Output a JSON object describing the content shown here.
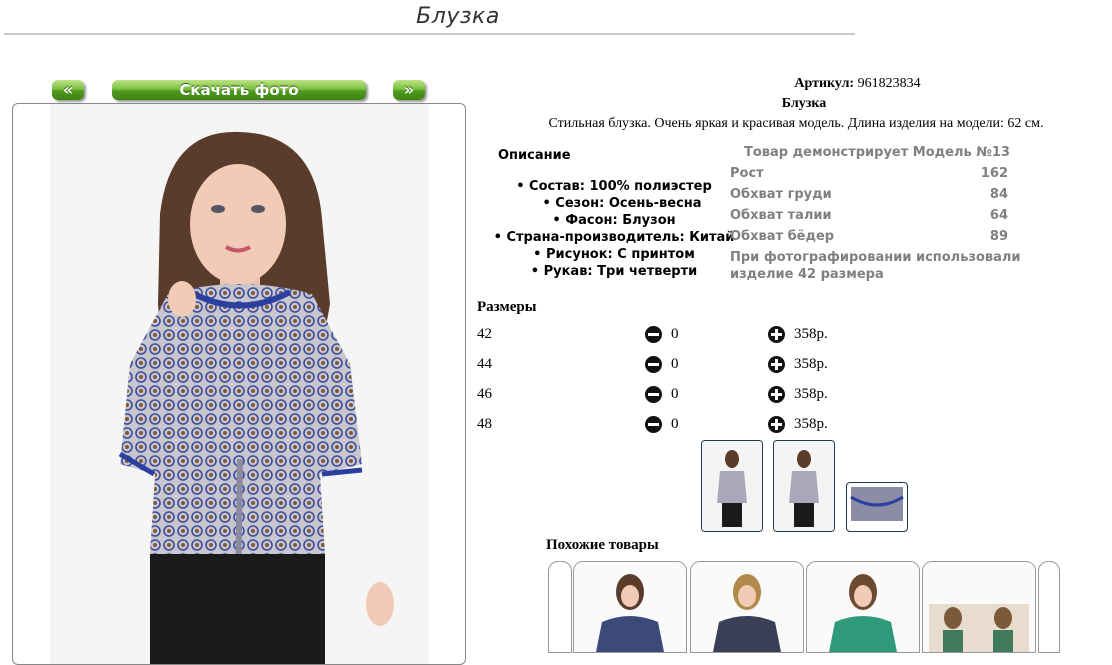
{
  "page": {
    "title": "Блузка"
  },
  "gallery": {
    "prev": "«",
    "download": "Скачать фото",
    "next": "»"
  },
  "product": {
    "article_label": "Артикул:",
    "article_value": "961823834",
    "name": "Блузка",
    "tagline": "Стильная блузка. Очень яркая и красивая модель. Длина изделия на модели: 62 см."
  },
  "description": {
    "heading": "Описание",
    "items": [
      "• Состав: 100% полиэстер",
      "• Сезон: Осень-весна",
      "• Фасон: Блузон",
      "• Страна-производитель: Китай",
      "• Рисунок: С принтом",
      "• Рукав: Три четверти"
    ]
  },
  "model": {
    "heading": "Товар демонстрирует Модель №13",
    "rows": [
      {
        "label": "Рост",
        "value": "162"
      },
      {
        "label": "Обхват груди",
        "value": "84"
      },
      {
        "label": "Обхват талии",
        "value": "64"
      },
      {
        "label": "Обхват бёдер",
        "value": "89"
      }
    ],
    "note_line1": "При фотографировании использовали",
    "note_line2": "изделие 42 размера"
  },
  "sizes": {
    "heading": "Размеры",
    "rows": [
      {
        "size": "42",
        "qty": "0",
        "price": "358р."
      },
      {
        "size": "44",
        "qty": "0",
        "price": "358р."
      },
      {
        "size": "46",
        "qty": "0",
        "price": "358р."
      },
      {
        "size": "48",
        "qty": "0",
        "price": "358р."
      }
    ]
  },
  "similar": {
    "heading": "Похожие товары"
  },
  "colors": {
    "button_green": "#5fa82a",
    "blouse_blue": "#2a3fa0",
    "border": "#888888"
  }
}
